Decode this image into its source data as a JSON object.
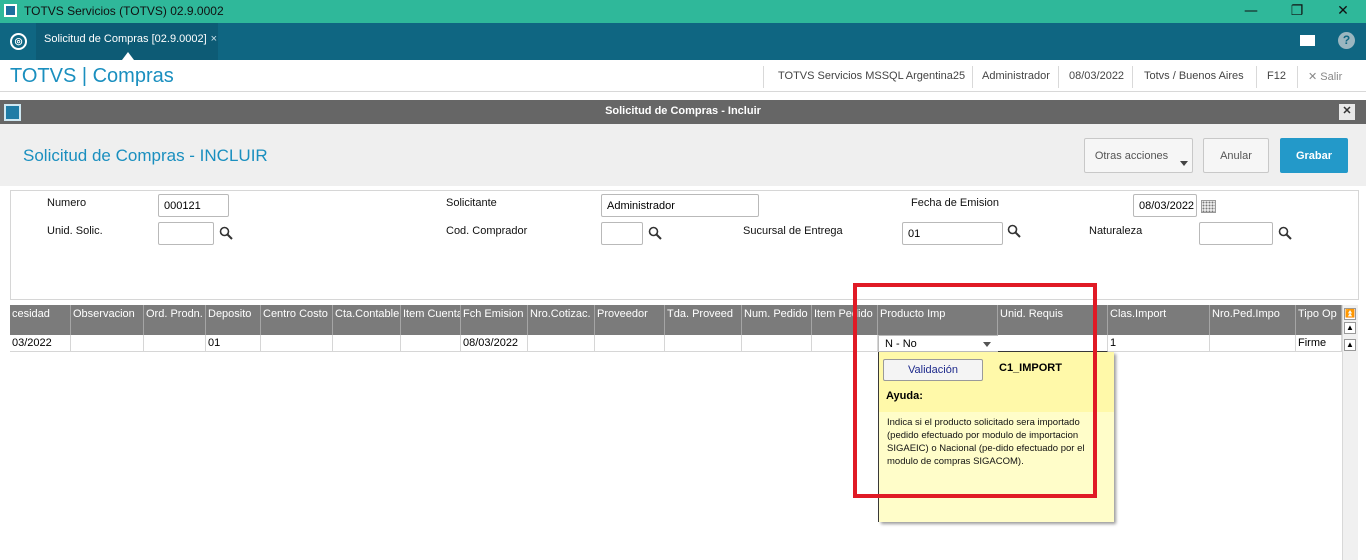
{
  "window": {
    "title": "TOTVS Servicios (TOTVS) 02.9.0002",
    "min_glyph": "—",
    "max_glyph": "❐",
    "close_glyph": "✕"
  },
  "tabs": {
    "active_tab": "Solicitud de Compras [02.9.0002]",
    "close_glyph": "×",
    "help_glyph": "?"
  },
  "module_header": {
    "brand": "TOTVS | Compras",
    "server": "TOTVS Servicios MSSQL Argentina25",
    "user": "Administrador",
    "date": "08/03/2022",
    "timezone": "Totvs / Buenos Aires",
    "f12": "F12",
    "exit": "Salir",
    "exit_glyph": "✕"
  },
  "dialog": {
    "title": "Solicitud de Compras - Incluir",
    "close_glyph": "✕",
    "page_title": "Solicitud de Compras - INCLUIR",
    "buttons": {
      "otras": "Otras acciones",
      "anular": "Anular",
      "grabar": "Grabar"
    }
  },
  "form": {
    "numero_label": "Numero",
    "numero_value": "000121",
    "solicitante_label": "Solicitante",
    "solicitante_value": "Administrador",
    "fecha_label": "Fecha de Emision",
    "fecha_value": "08/03/2022",
    "unid_label": "Unid. Solic.",
    "unid_value": "",
    "comprador_label": "Cod. Comprador",
    "comprador_value": "",
    "sucursal_label": "Sucursal de Entrega",
    "sucursal_value": "01",
    "naturaleza_label": "Naturaleza",
    "naturaleza_value": ""
  },
  "grid": {
    "columns": [
      "cesidad",
      "Observacion",
      "Ord. Prodn.",
      "Deposito",
      "Centro Costo",
      "Cta.Contable",
      "Item Cuenta",
      "Fch Emision",
      "Nro.Cotizac.",
      "Proveedor",
      "Tda. Proveed",
      "Num. Pedido",
      "Item Pedido",
      "Producto Imp",
      "Unid. Requis",
      "Clas.Import",
      "Nro.Ped.Impo",
      "Tipo Op"
    ],
    "row": [
      "03/2022",
      "",
      "",
      "01",
      "",
      "",
      "",
      "08/03/2022",
      "",
      "",
      "",
      "",
      "",
      "N - No",
      "",
      "1",
      "",
      "Firme"
    ]
  },
  "tooltip": {
    "button": "Validación",
    "field": "C1_IMPORT",
    "help_title": "Ayuda:",
    "help_text": "Indica si el producto solicitado sera importado (pedido efectuado por modulo de importacion SIGAEIC) o Nacional (pe-dido efectuado por el modulo de compras SIGACOM)."
  },
  "colors": {
    "titlebar": "#2fb89a",
    "tabsbar": "#0f6682",
    "accent": "#2399c9",
    "grid_header": "#7b7b7b",
    "highlight_box": "#e01a25",
    "tooltip_bg": "#fffdc9"
  },
  "icons": [
    "app-icon",
    "totvs-logo-icon",
    "mail-icon",
    "help-icon",
    "search-icon",
    "calendar-icon",
    "dropdown-arrow-icon",
    "scroll-arrow-icon"
  ]
}
